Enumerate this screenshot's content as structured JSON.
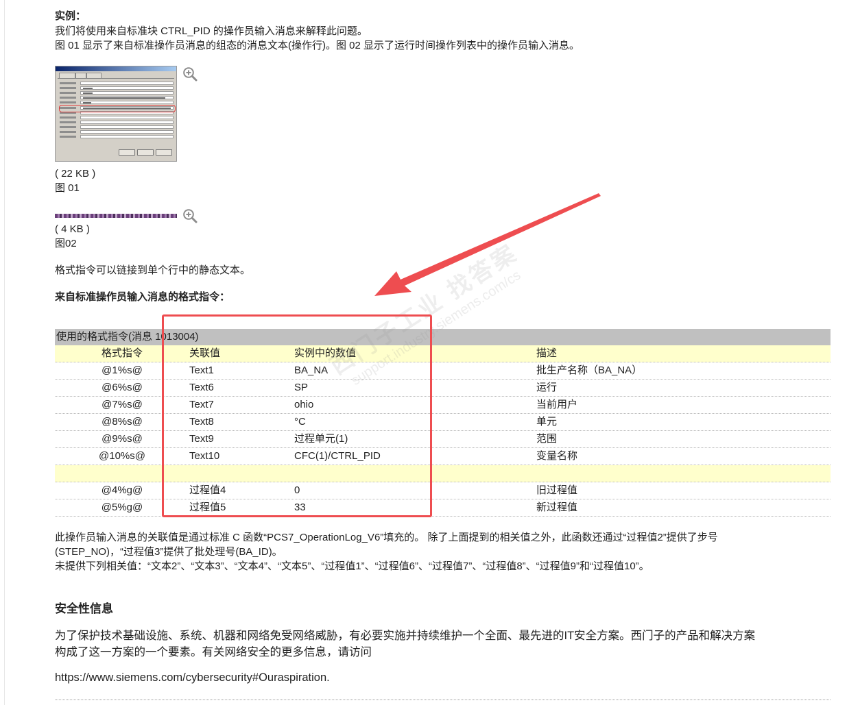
{
  "example": {
    "heading": "实例：",
    "line1": "我们将使用来自标准块 CTRL_PID 的操作员输入消息来解释此问题。",
    "line2": "图 01 显示了来自标准操作员消息的组态的消息文本(操作行)。图 02 显示了运行时间操作列表中的操作员输入消息。"
  },
  "figure1": {
    "size": "( 22 KB )",
    "caption": "图 01",
    "zoom_icon": "zoom-in-icon"
  },
  "figure2": {
    "size": "( 4 KB )",
    "caption": "图02",
    "zoom_icon": "zoom-in-icon"
  },
  "note": "格式指令可以链接到单个行中的静态文本。",
  "format_heading": "来自标准操作员输入消息的格式指令：",
  "table": {
    "title": "使用的格式指令(消息 1013004)",
    "columns": [
      "格式指令",
      "关联值",
      "实例中的数值",
      "描述"
    ],
    "rows": [
      [
        "@1%s@",
        "Text1",
        "BA_NA",
        "批生产名称（BA_NA）"
      ],
      [
        "@6%s@",
        "Text6",
        "SP",
        "运行"
      ],
      [
        "@7%s@",
        "Text7",
        "ohio",
        "当前用户"
      ],
      [
        "@8%s@",
        "Text8",
        "°C",
        "单元"
      ],
      [
        "@9%s@",
        "Text9",
        "过程单元(1)",
        "范围"
      ],
      [
        "@10%s@",
        "Text10",
        "CFC(1)/CTRL_PID",
        "变量名称"
      ],
      [
        "",
        "",
        "",
        ""
      ],
      [
        "@4%g@",
        "过程值4",
        "0",
        "旧过程值"
      ],
      [
        "@5%g@",
        "过程值5",
        "33",
        "新过程值"
      ]
    ]
  },
  "explanation": {
    "line1": "此操作员输入消息的关联值是通过标准 C 函数“PCS7_OperationLog_V6”填充的。 除了上面提到的相关值之外，此函数还通过“过程值2”提供了步号",
    "line2": "(STEP_NO)，“过程值3”提供了批处理号(BA_ID)。",
    "line3": "未提供下列相关值：“文本2”、“文本3”、“文本4”、“文本5”、“过程值1”、“过程值6”、“过程值7”、“过程值8”、“过程值9”和“过程值10”。"
  },
  "security": {
    "title": "安全性信息",
    "line1": "为了保护技术基础设施、系统、机器和网络免受网络威胁，有必要实施并持续维护一个全面、最先进的IT安全方案。西门子的产品和解决方案",
    "line2": "构成了这一方案的一个要素。有关网络安全的更多信息，请访问",
    "link": "https://www.siemens.com/cybersecurity#Ouraspiration."
  },
  "watermark": {
    "line1": "西门子工业 找答案",
    "line2": "support.industry.siemens.com/cs"
  },
  "colors": {
    "annotation_red": "#ee4d50",
    "table_header_gray": "#c0c0c0",
    "column_row_yellow": "#ffffcc"
  }
}
